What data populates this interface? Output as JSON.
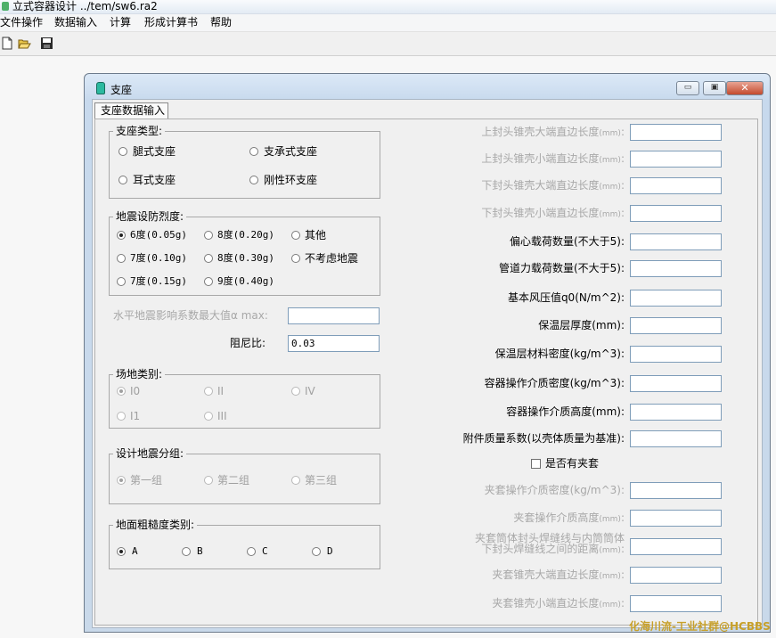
{
  "app": {
    "title": "立式容器设计 ../tem/sw6.ra2"
  },
  "menu": [
    "文件操作",
    "数据输入",
    "计算",
    "形成计算书",
    "帮助"
  ],
  "toolbar": {
    "icons": [
      "new-file-icon",
      "open-folder-icon",
      "save-disk-icon"
    ]
  },
  "window": {
    "title": "支座",
    "tab": "支座数据输入",
    "buttons": {
      "minimize": "▭",
      "maximize": "▣",
      "close": "✕"
    }
  },
  "support_type": {
    "legend": "支座类型:",
    "options": [
      "腿式支座",
      "支承式支座",
      "耳式支座",
      "刚性环支座"
    ],
    "selected": null
  },
  "seismic_intensity": {
    "legend": "地震设防烈度:",
    "options": [
      "6度(0.05g)",
      "8度(0.20g)",
      "其他",
      "7度(0.10g)",
      "8度(0.30g)",
      "不考虑地震",
      "7度(0.15g)",
      "9度(0.40g)"
    ],
    "selected": "6度(0.05g)"
  },
  "alpha_max": {
    "label": "水平地震影响系数最大值α max:",
    "value": ""
  },
  "damping": {
    "label": "阻尼比:",
    "value": "0.03"
  },
  "site_category": {
    "legend": "场地类别:",
    "options": [
      "I0",
      "II",
      "IV",
      "I1",
      "III"
    ],
    "selected": "I0"
  },
  "design_group": {
    "legend": "设计地震分组:",
    "options": [
      "第一组",
      "第二组",
      "第三组"
    ],
    "selected": "第一组"
  },
  "ground_roughness": {
    "legend": "地面粗糙度类别:",
    "options": [
      "A",
      "B",
      "C",
      "D"
    ],
    "selected": "A"
  },
  "right_fields": [
    {
      "label": "上封头锥壳大端直边长度",
      "unit": "(mm)",
      "suffix": ":",
      "value": "",
      "enabled": false
    },
    {
      "label": "上封头锥壳小端直边长度",
      "unit": "(mm)",
      "suffix": ":",
      "value": "",
      "enabled": false
    },
    {
      "label": "下封头锥壳大端直边长度",
      "unit": "(mm)",
      "suffix": ":",
      "value": "",
      "enabled": false
    },
    {
      "label": "下封头锥壳小端直边长度",
      "unit": "(mm)",
      "suffix": ":",
      "value": "",
      "enabled": false
    },
    {
      "label": "偏心载荷数量(不大于5)",
      "unit": "",
      "suffix": ":",
      "value": "",
      "enabled": true
    },
    {
      "label": "管道力载荷数量(不大于5)",
      "unit": "",
      "suffix": ":",
      "value": "",
      "enabled": true
    },
    {
      "label": "基本风压值q0(N/m^2)",
      "unit": "",
      "suffix": ":",
      "value": "",
      "enabled": true
    },
    {
      "label": "保温层厚度(mm)",
      "unit": "",
      "suffix": ":",
      "value": "",
      "enabled": true
    },
    {
      "label": "保温层材料密度(kg/m^3)",
      "unit": "",
      "suffix": ":",
      "value": "",
      "enabled": true
    },
    {
      "label": "容器操作介质密度(kg/m^3)",
      "unit": "",
      "suffix": ":",
      "value": "",
      "enabled": true
    },
    {
      "label": "容器操作介质高度(mm)",
      "unit": "",
      "suffix": ":",
      "value": "",
      "enabled": true
    },
    {
      "label": "附件质量系数(以壳体质量为基准)",
      "unit": "",
      "suffix": ":",
      "value": "",
      "enabled": true
    }
  ],
  "jacket_checkbox": {
    "label": "是否有夹套",
    "checked": false
  },
  "jacket_fields": [
    {
      "label": "夹套操作介质密度(kg/m^3)",
      "unit": "",
      "suffix": ":",
      "value": ""
    },
    {
      "label": "夹套操作介质高度",
      "unit": "(mm)",
      "suffix": ":",
      "value": ""
    },
    {
      "label_lines": [
        "夹套筒体封头焊缝线与内筒筒体",
        "下封头焊缝线之间的距离"
      ],
      "unit": "(mm)",
      "suffix": ":",
      "value": ""
    },
    {
      "label": "夹套锥壳大端直边长度",
      "unit": "(mm)",
      "suffix": ":",
      "value": ""
    },
    {
      "label": "夹套锥壳小端直边长度",
      "unit": "(mm)",
      "suffix": ":",
      "value": ""
    }
  ],
  "watermark": "化海川流-工业社群@HCBBS",
  "colors": {
    "disabled_text": "#a0a0a0",
    "field_border": "#7f9db9",
    "watermark": "#c7a02a"
  }
}
